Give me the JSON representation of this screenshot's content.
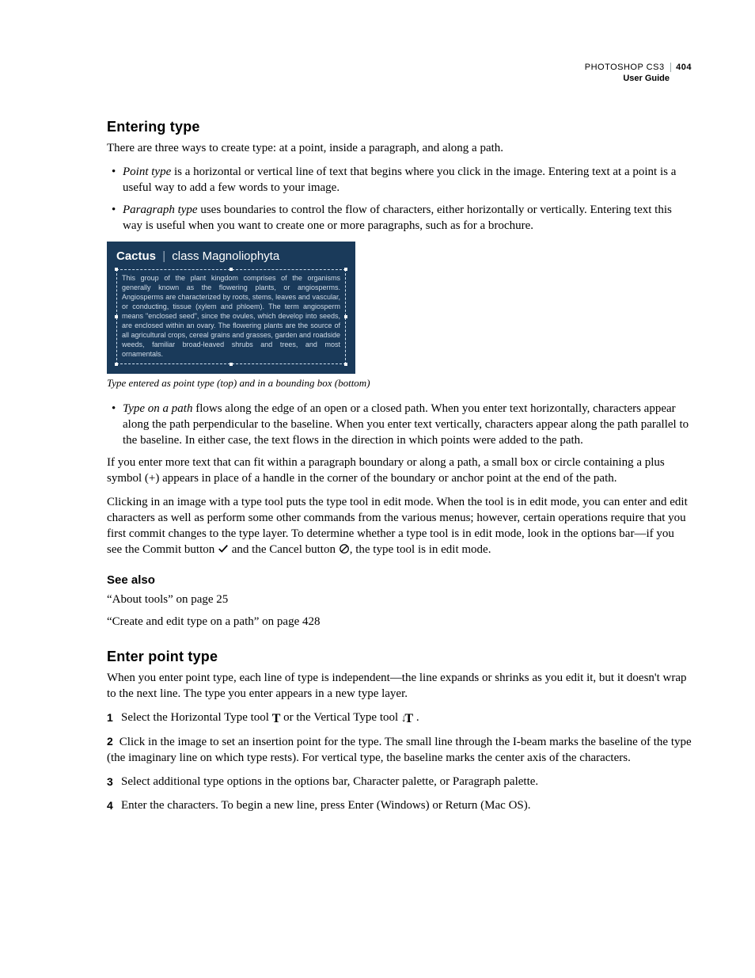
{
  "header": {
    "product": "PHOTOSHOP CS3",
    "page_number": "404",
    "subtitle": "User Guide"
  },
  "section1": {
    "title": "Entering type",
    "intro": "There are three ways to create type: at a point, inside a paragraph, and along a path.",
    "b1_term": "Point type",
    "b1_rest": " is a horizontal or vertical line of text that begins where you click in the image. Entering text at a point is a useful way to add a few words to your image.",
    "b2_term": "Paragraph type",
    "b2_rest": " uses boundaries to control the flow of characters, either horizontally or vertically. Entering text this way is useful when you want to create one or more paragraphs, such as for a brochure.",
    "fig_title_bold": "Cactus",
    "fig_title_sep": "|",
    "fig_title_rest": "class Magnoliophyta",
    "fig_body": "This group of the plant kingdom comprises of the organisms generally known as the flowering plants, or angiosperms. Angiosperms are characterized by roots, stems, leaves and vascular, or conducting, tissue (xylem and phloem). The term angiosperm means \"enclosed seed\", since the ovules, which develop into seeds, are enclosed within an ovary. The flowering plants are the source of all agricultural crops, cereal grains and grasses, garden and roadside weeds, familiar broad-leaved shrubs and trees, and most ornamentals.",
    "caption": "Type entered as point type (top) and in a bounding box (bottom)",
    "b3_term": "Type on a path",
    "b3_rest": " flows along the edge of an open or a closed path. When you enter text horizontally, characters appear along the path perpendicular to the baseline. When you enter text vertically, characters appear along the path parallel to the baseline. In either case, the text flows in the direction in which points were added to the path.",
    "p_overflow": "If you enter more text that can fit within a paragraph boundary or along a path, a small box or circle containing a plus symbol (+) appears in place of a handle in the corner of the boundary or anchor point at the end of the path.",
    "p_edit_a": "Clicking in an image with a type tool puts the type tool in edit mode. When the tool is in edit mode, you can enter and edit characters as well as perform some other commands from the various menus; however, certain operations require that you first commit changes to the type layer. To determine whether a type tool is in edit mode, look in the options bar—if you see the Commit button ",
    "p_edit_b": " and the Cancel button ",
    "p_edit_c": ", the type tool is in edit mode."
  },
  "seealso": {
    "heading": "See also",
    "link1": "“About tools” on page 25",
    "link2": "“Create and edit type on a path” on page 428"
  },
  "section2": {
    "title": "Enter point type",
    "intro": "When you enter point type, each line of type is independent—the line expands or shrinks as you edit it, but it doesn't wrap to the next line. The type you enter appears in a new type layer.",
    "s1_a": "Select the Horizontal Type tool ",
    "s1_b": " or the Vertical Type tool ",
    "s1_c": " .",
    "s2": "Click in the image to set an insertion point for the type. The small line through the I-beam marks the baseline of the type (the imaginary line on which type rests). For vertical type, the baseline marks the center axis of the characters.",
    "s3": "Select additional type options in the options bar, Character palette, or Paragraph palette.",
    "s4": "Enter the characters. To begin a new line, press Enter (Windows) or Return (Mac OS).",
    "n1": "1",
    "n2": "2",
    "n3": "3",
    "n4": "4"
  }
}
